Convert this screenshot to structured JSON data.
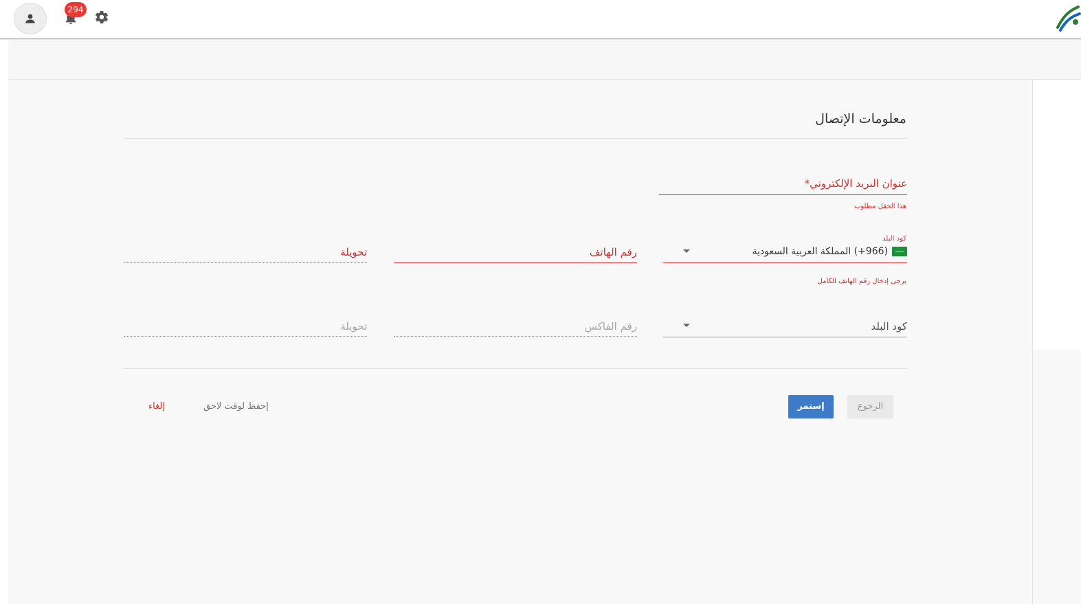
{
  "topbar": {
    "notification_count": "294"
  },
  "form": {
    "title": "معلومات الإتصال",
    "email": {
      "label": "عنوان البريد الإلكتروني*",
      "error": "هذا الحقل مطلوب"
    },
    "phone_row": {
      "country_code_small_label": "كود البلد",
      "country_code_value": "(966+) المملكة العربية السعودية",
      "phone_label": "رقم الهاتف",
      "extension_label": "تحويلة",
      "error": "يرجى إدخال رقم الهاتف الكامل"
    },
    "fax_row": {
      "country_code_label": "كود البلد",
      "fax_label": "رقم الفاكس",
      "extension_label": "تحويلة"
    }
  },
  "actions": {
    "continue_label": "إستمر",
    "back_label": "الرجوع",
    "save_later_label": "إحفظ لوقت لاحق",
    "cancel_label": "إلغاء"
  },
  "colors": {
    "error": "#d32f2f",
    "primary_button": "#3e7bc9",
    "badge": "#e53935"
  }
}
